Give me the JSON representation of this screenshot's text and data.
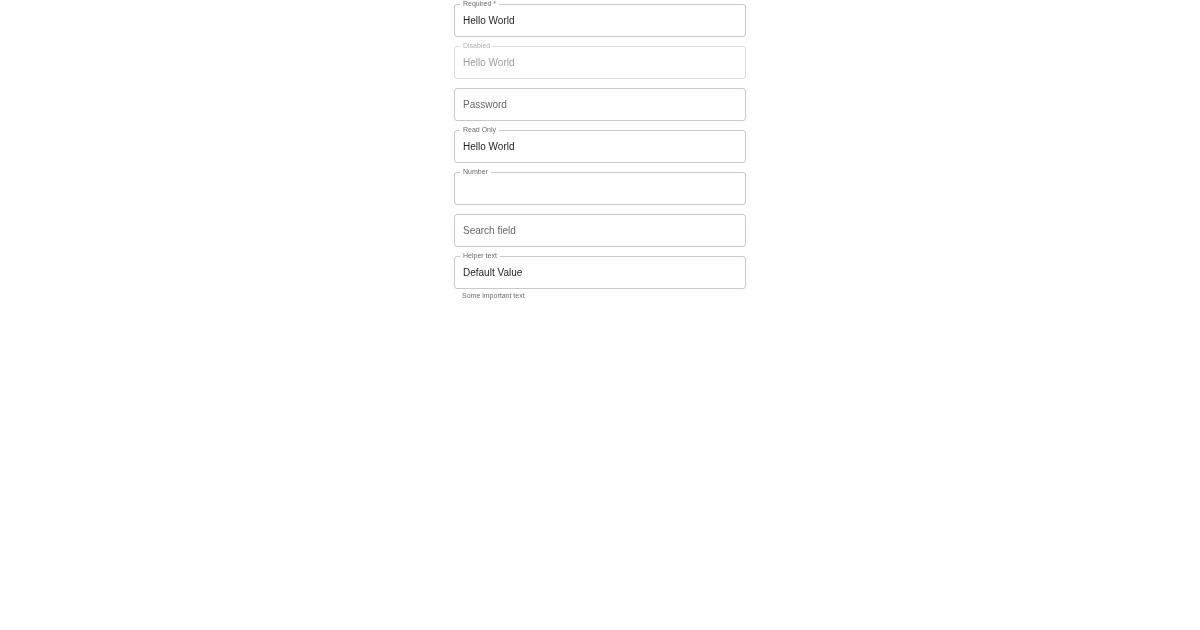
{
  "fields": [
    {
      "label": "Required *",
      "floated": true,
      "value": "Hello World",
      "disabled": false
    },
    {
      "label": "Disabled",
      "floated": true,
      "value": "Hello World",
      "disabled": true
    },
    {
      "label": "Password",
      "floated": false,
      "disabled": false
    },
    {
      "label": "Read Only",
      "floated": true,
      "value": "Hello World",
      "disabled": false
    },
    {
      "label": "Number",
      "floated": true,
      "disabled": false
    },
    {
      "label": "Search field",
      "floated": false,
      "disabled": false
    },
    {
      "label": "Helper text",
      "floated": true,
      "value": "Default Value",
      "disabled": false,
      "helper": "Some important text"
    }
  ]
}
